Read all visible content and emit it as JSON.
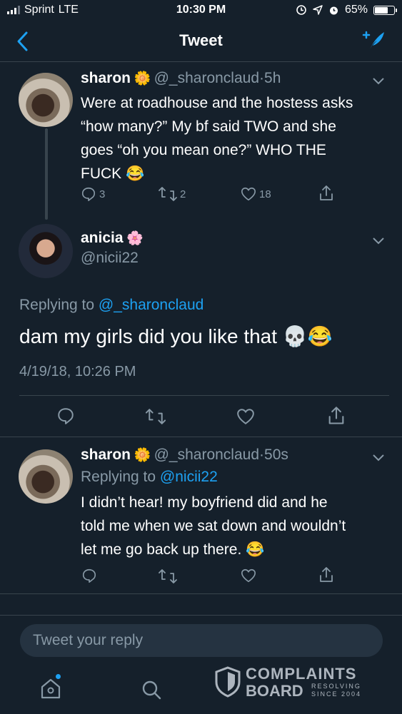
{
  "status_bar": {
    "carrier": "Sprint",
    "network": "LTE",
    "time": "10:30 PM",
    "battery": "65%",
    "battery_level": 0.65
  },
  "nav": {
    "title": "Tweet",
    "back_icon": "chevron-left-icon",
    "compose_icon": "compose-tweet-icon"
  },
  "tweets": [
    {
      "name": "sharon",
      "emoji": "🌼",
      "handle": "@_sharonclaud",
      "time": "5h",
      "text_lines": [
        "Were at roadhouse and the hostess asks",
        "“how many?” My bf said TWO and she",
        "goes “oh you mean one?” WHO THE",
        "FUCK 😂"
      ],
      "replies": "3",
      "retweets": "2",
      "likes": "18"
    }
  ],
  "focus_tweet": {
    "name": "anicia",
    "emoji": "🌸",
    "handle": "@nicii22",
    "replying_prefix": "Replying to",
    "replying_handle": "@_sharonclaud",
    "text": "dam my girls did you like that 💀😂",
    "timestamp": "4/19/18, 10:26 PM"
  },
  "reply_tweet": {
    "name": "sharon",
    "emoji": "🌼",
    "handle": "@_sharonclaud",
    "time": "50s",
    "replying_prefix": "Replying to",
    "replying_handle": "@nicii22",
    "text_lines": [
      "I didn’t hear! my boyfriend did and he",
      "told me when we sat down and wouldn’t",
      "let me go back up there. 😂"
    ]
  },
  "reply_placeholder": "Tweet your reply",
  "watermark": {
    "line1": "COMPLAINTS",
    "line2": "BOARD",
    "tag1": "RESOLVING",
    "tag2": "SINCE 2004"
  },
  "colors": {
    "background": "#15202b",
    "accent": "#1da1f2",
    "muted": "#8899a6",
    "divider": "#38444d"
  }
}
